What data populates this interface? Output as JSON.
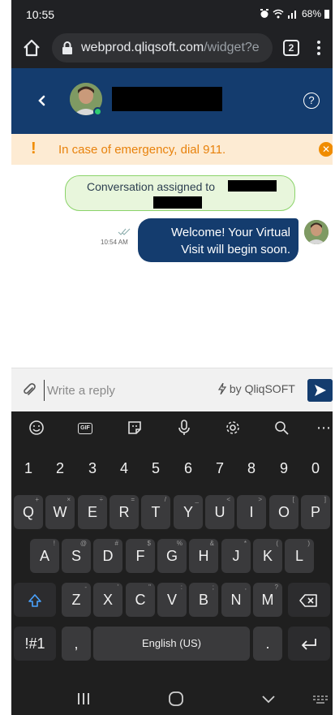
{
  "status_bar": {
    "time": "10:55",
    "battery": "68%"
  },
  "browser": {
    "url_host": "webprod.qliqsoft.com",
    "url_path": "/widget?e",
    "tab_count": "2"
  },
  "chat_header": {
    "help_label": "?"
  },
  "banner": {
    "message": "In case of emergency, dial 911."
  },
  "conversation": {
    "assigned_text": "Conversation assigned to",
    "messages": [
      {
        "line1": "Welcome! Your Virtual",
        "line2": "Visit will begin soon.",
        "time": "10:54 AM"
      }
    ]
  },
  "reply": {
    "placeholder": "Write a reply",
    "powered_by": "by QliqSOFT"
  },
  "keyboard": {
    "number_row": [
      "1",
      "2",
      "3",
      "4",
      "5",
      "6",
      "7",
      "8",
      "9",
      "0"
    ],
    "row1": [
      "Q",
      "W",
      "E",
      "R",
      "T",
      "Y",
      "U",
      "I",
      "O",
      "P"
    ],
    "row1_hints": [
      "+",
      "×",
      "÷",
      "=",
      "/",
      "_",
      "<",
      ">",
      "[",
      "]"
    ],
    "row2": [
      "A",
      "S",
      "D",
      "F",
      "G",
      "H",
      "J",
      "K",
      "L"
    ],
    "row2_hints": [
      "!",
      "@",
      "#",
      "$",
      "%",
      "&",
      "*",
      "(",
      ")"
    ],
    "row3": [
      "Z",
      "X",
      "C",
      "V",
      "B",
      "N",
      "M"
    ],
    "row3_hints": [
      "-",
      "'",
      "\"",
      ":",
      ";",
      ",",
      "?"
    ],
    "symbols_label": "!#1",
    "comma_label": ",",
    "space_label": "English (US)",
    "period_label": ".",
    "toolbar": {
      "gif_label": "GIF"
    }
  },
  "colors": {
    "brand": "#143c6e",
    "warning": "#f08c00",
    "bubble_green": "#e8f6dc"
  }
}
